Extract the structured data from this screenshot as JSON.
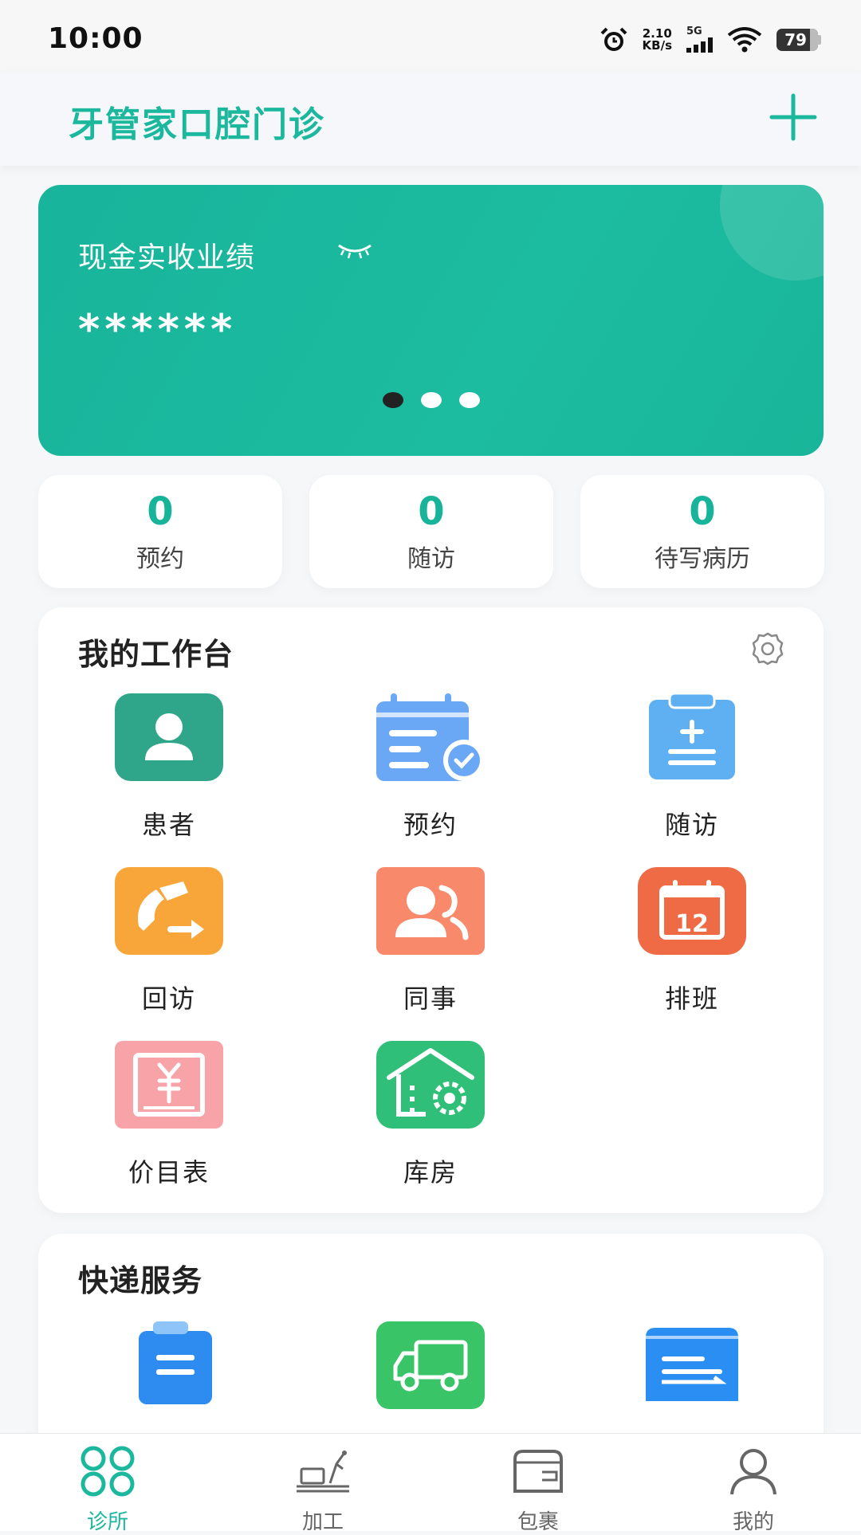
{
  "status_bar": {
    "time": "10:00",
    "net_speed_value": "2.10",
    "net_speed_unit": "KB/s",
    "network_type": "5G",
    "battery_level": "79",
    "icons": [
      "alarm-icon",
      "signal-icon",
      "wifi-icon",
      "battery-icon"
    ]
  },
  "header": {
    "title": "牙管家口腔门诊",
    "add_icon": "plus-icon",
    "accent_color": "#1bb89d"
  },
  "banner": {
    "label": "现金实收业绩",
    "masked_value": "******",
    "visibility_icon": "eye-closed-icon",
    "pages": 3,
    "active_page": 1
  },
  "stats": [
    {
      "value": "0",
      "label": "预约"
    },
    {
      "value": "0",
      "label": "随访"
    },
    {
      "value": "0",
      "label": "待写病历"
    }
  ],
  "workbench": {
    "title": "我的工作台",
    "settings_icon": "gear-icon",
    "items": [
      {
        "label": "患者",
        "icon": "patient-icon",
        "color": "#2fa58a"
      },
      {
        "label": "预约",
        "icon": "calendar-check-icon",
        "color": "#6aa8f5"
      },
      {
        "label": "随访",
        "icon": "clipboard-plus-icon",
        "color": "#5fb0f2"
      },
      {
        "label": "回访",
        "icon": "phone-forward-icon",
        "color": "#f8a63a"
      },
      {
        "label": "同事",
        "icon": "colleagues-icon",
        "color": "#f8896a"
      },
      {
        "label": "排班",
        "icon": "schedule-calendar-icon",
        "color": "#ef6b45"
      },
      {
        "label": "价目表",
        "icon": "price-list-icon",
        "color": "#f7a3a8"
      },
      {
        "label": "库房",
        "icon": "warehouse-icon",
        "color": "#2fbf78"
      }
    ]
  },
  "express": {
    "title": "快递服务",
    "items": [
      {
        "icon": "clipboard-list-icon",
        "color": "#2e8cf0"
      },
      {
        "icon": "truck-icon",
        "color": "#39c467"
      },
      {
        "icon": "express-box-icon",
        "color": "#2b8ef3"
      }
    ]
  },
  "bottom_nav": [
    {
      "label": "诊所",
      "icon": "clinic-grid-icon",
      "active": true
    },
    {
      "label": "加工",
      "icon": "processing-icon",
      "active": false
    },
    {
      "label": "包裹",
      "icon": "package-icon",
      "active": false
    },
    {
      "label": "我的",
      "icon": "user-icon",
      "active": false
    }
  ]
}
